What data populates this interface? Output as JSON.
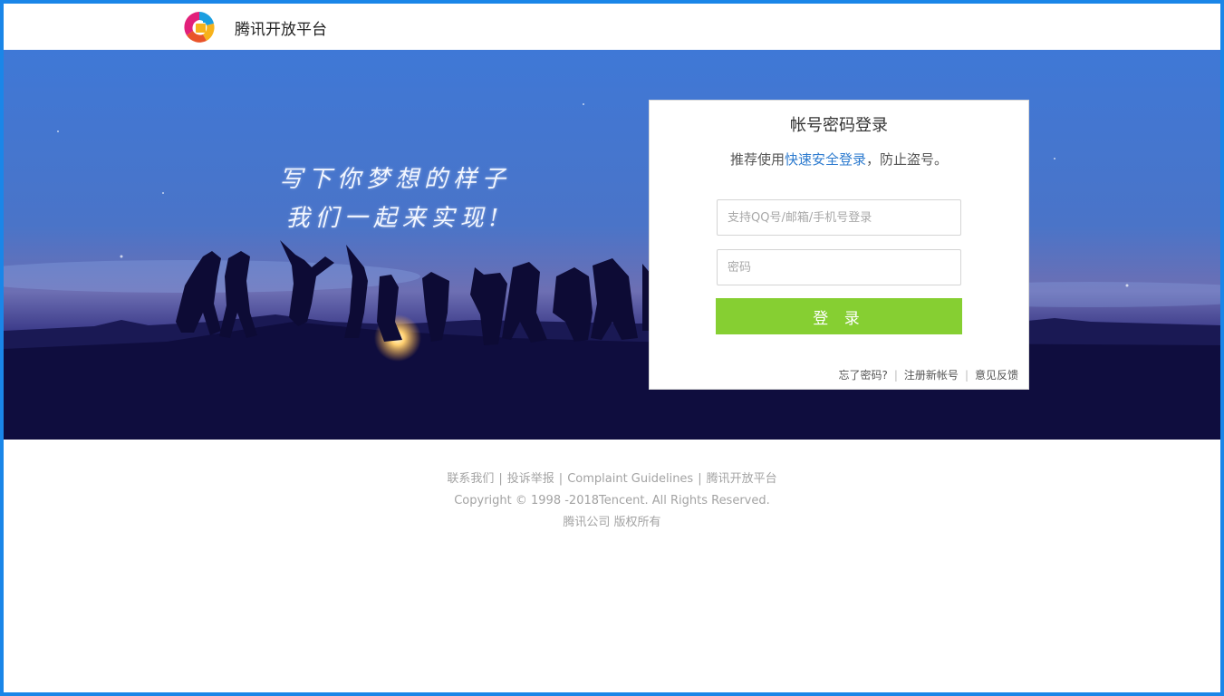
{
  "header": {
    "site_name": "腾讯开放平台",
    "logo_icon": "tencent-open-platform-logo"
  },
  "banner": {
    "slogan_line1": "写下你梦想的样子",
    "slogan_line2": "我们一起来实现!"
  },
  "login": {
    "title": "帐号密码登录",
    "tip_prefix": "推荐使用",
    "tip_link": "快速安全登录",
    "tip_suffix": "，防止盗号。",
    "account_placeholder": "支持QQ号/邮箱/手机号登录",
    "password_placeholder": "密码",
    "submit_label": "登 录",
    "forgot_password": "忘了密码?",
    "register": "注册新帐号",
    "feedback": "意见反馈",
    "link_separator": "|"
  },
  "footer": {
    "links": [
      "联系我们",
      "投诉举报",
      "Complaint Guidelines",
      "腾讯开放平台"
    ],
    "separator": "|",
    "copyright": "Copyright © 1998 -2018Tencent. All Rights Reserved.",
    "company": "腾讯公司 版权所有"
  },
  "colors": {
    "accent_blue": "#1a86e8",
    "login_button": "#86cf32",
    "link_blue": "#2d7bcf"
  }
}
